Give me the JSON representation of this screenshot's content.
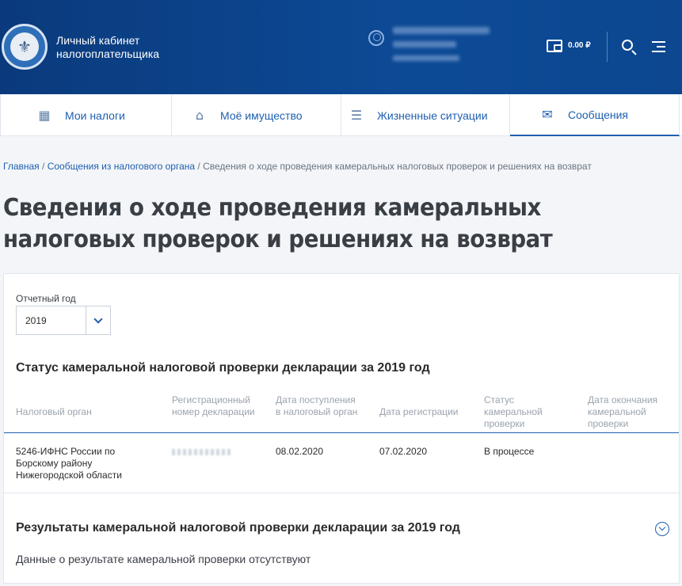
{
  "header": {
    "brand_line1": "Личный кабинет",
    "brand_line2": "налогоплательщика",
    "balance": "0.00 ₽",
    "emblem_icon": "tax-service-emblem-icon",
    "user_icon": "user-icon",
    "wallet_icon": "wallet-icon",
    "search_icon": "search-icon",
    "menu_icon": "menu-icon"
  },
  "nav": {
    "items": [
      {
        "label": "Мои налоги",
        "icon": "calculator-icon"
      },
      {
        "label": "Моё имущество",
        "icon": "house-icon"
      },
      {
        "label": "Жизненные ситуации",
        "icon": "list-icon"
      },
      {
        "label": "Сообщения",
        "icon": "envelope-icon",
        "active": true
      }
    ]
  },
  "breadcrumb": {
    "home": "Главная",
    "sep": " / ",
    "messages": "Сообщения из налогового органа",
    "current": "Сведения о ходе проведения камеральных налоговых проверок и решениях на возврат"
  },
  "page": {
    "title": "Сведения о ходе проведения камеральных налоговых проверок и решениях на возврат"
  },
  "filter": {
    "label": "Отчетный год",
    "value": "2019"
  },
  "status_section": {
    "title": "Статус камеральной налоговой проверки декларации за 2019 год",
    "columns": [
      "Налоговый орган",
      "Регистрационный номер декларации",
      "Дата поступления в налоговый орган",
      "Дата регистрации",
      "Статус камеральной проверки",
      "Дата окончания камеральной проверки"
    ],
    "rows": [
      {
        "tax_office": "5246-ИФНС России по Борскому району Нижегородской области",
        "received": "08.02.2020",
        "registered": "07.02.2020",
        "status": "В процессе",
        "end_date": ""
      }
    ]
  },
  "results_section": {
    "title": "Результаты камеральной налоговой проверки декларации за 2019 год",
    "empty": "Данные о результате камеральной проверки отсутствуют"
  },
  "colors": {
    "header_bg": "#0c4790",
    "accent": "#1f5fb0",
    "muted": "#9aa3ae"
  }
}
